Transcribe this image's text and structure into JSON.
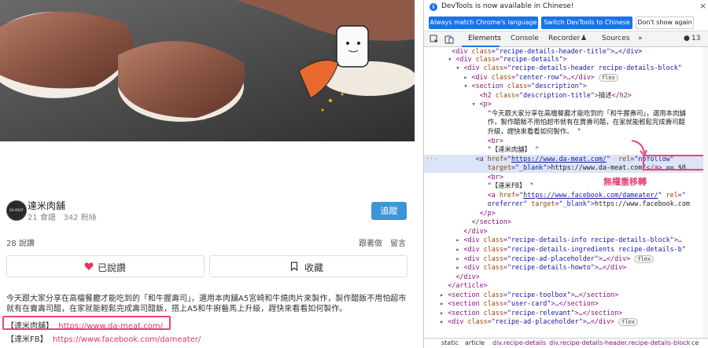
{
  "left": {
    "author": {
      "avatar_text": "DA-MEAT",
      "name": "達米肉舖",
      "recipes": "21 食譜",
      "fans": "342 粉絲",
      "follow_label": "追蹤"
    },
    "counts": {
      "comments": "28 說讚",
      "follow_cook": "跟著做",
      "message": "留言"
    },
    "actions": {
      "said_label": "已說讚",
      "save_label": "收藏"
    },
    "description": "今天跟大家分享在高檔餐廳才能吃到的「和牛握壽司」，選用本肉舖A5宮崎和牛燒肉片來製作，製作醋飯不用怕超市就有在賣壽司醋，在家就能輕鬆完成壽司醋飯，搭上A5和牛廚藝馬上升級，趕快來看看如何製作。",
    "link1_label": "【達米肉舖】",
    "link1_url": "https://www.da-meat.com/",
    "link2_label": "【達米FB】",
    "link2_url": "https://www.facebook.com/dameater/"
  },
  "devtools": {
    "info_text": "DevTools is now available in Chinese!",
    "btn_match": "Always match Chrome's language",
    "btn_switch": "Switch DevTools to Chinese",
    "btn_dont": "Don't show again",
    "tabs": [
      "Elements",
      "Console",
      "Recorder",
      "Sources"
    ],
    "more_tabs": "»",
    "issues_count": "13",
    "annotation": "無權重移轉",
    "lines": {
      "l0_a": "<div ",
      "l0_b": "class",
      "l0_c": "=\"recipe-details-header-title\">…</div>",
      "l1": "recipe-details",
      "l2": "recipe-details-header recipe-details-block",
      "l3": "center-row",
      "l4": "description",
      "l5_cls": "description-title",
      "l5_txt": "描述",
      "l7": "\"今天跟大家分享在高檔餐廳才能吃到的「和牛握壽司」，選用本肉舖",
      "l8": "作，製作醋飯不用怕超市就有在賣壽司醋，在家就能輕鬆完成壽司醋",
      "l9": "升級，趕快來看看如何製作。 \"",
      "l11": "\"【達米肉舖】 \"",
      "l12_href": "https://www.da-meat.com/",
      "l12_rel": "nofollow",
      "l13_target": "_blank",
      "l13_txt": "https://www.da-meat.com/",
      "l13_eq": "== $0",
      "l15": "\"【達米FB】 \"",
      "l16_href": "https://www.facebook.com/dameater/",
      "l17_rel": "oreferrer",
      "l17_target": "_blank",
      "l17_txt": "https://www.facebook.com",
      "l22": "recipe-details-info recipe-details-block",
      "l23": "recipe-details-ingredients recipe-details-b",
      "l24": "recipe-ad-placeholder",
      "l25": "recipe-details-howto",
      "l28": "recipe-toolbox",
      "l29": "user-card",
      "l30": "recipe-relevant",
      "l31": "recipe-ad-placeholder",
      "badge_flex": "flex"
    },
    "crumbs": [
      "static",
      "article",
      "div.recipe-details",
      "div.recipe-details-header.recipe-details-block",
      "ce"
    ]
  },
  "colors": {
    "accent_pink": "#e8447a",
    "follow_blue": "#3c95d8",
    "devtools_blue": "#1a73e8",
    "link_red": "#e0375e"
  }
}
